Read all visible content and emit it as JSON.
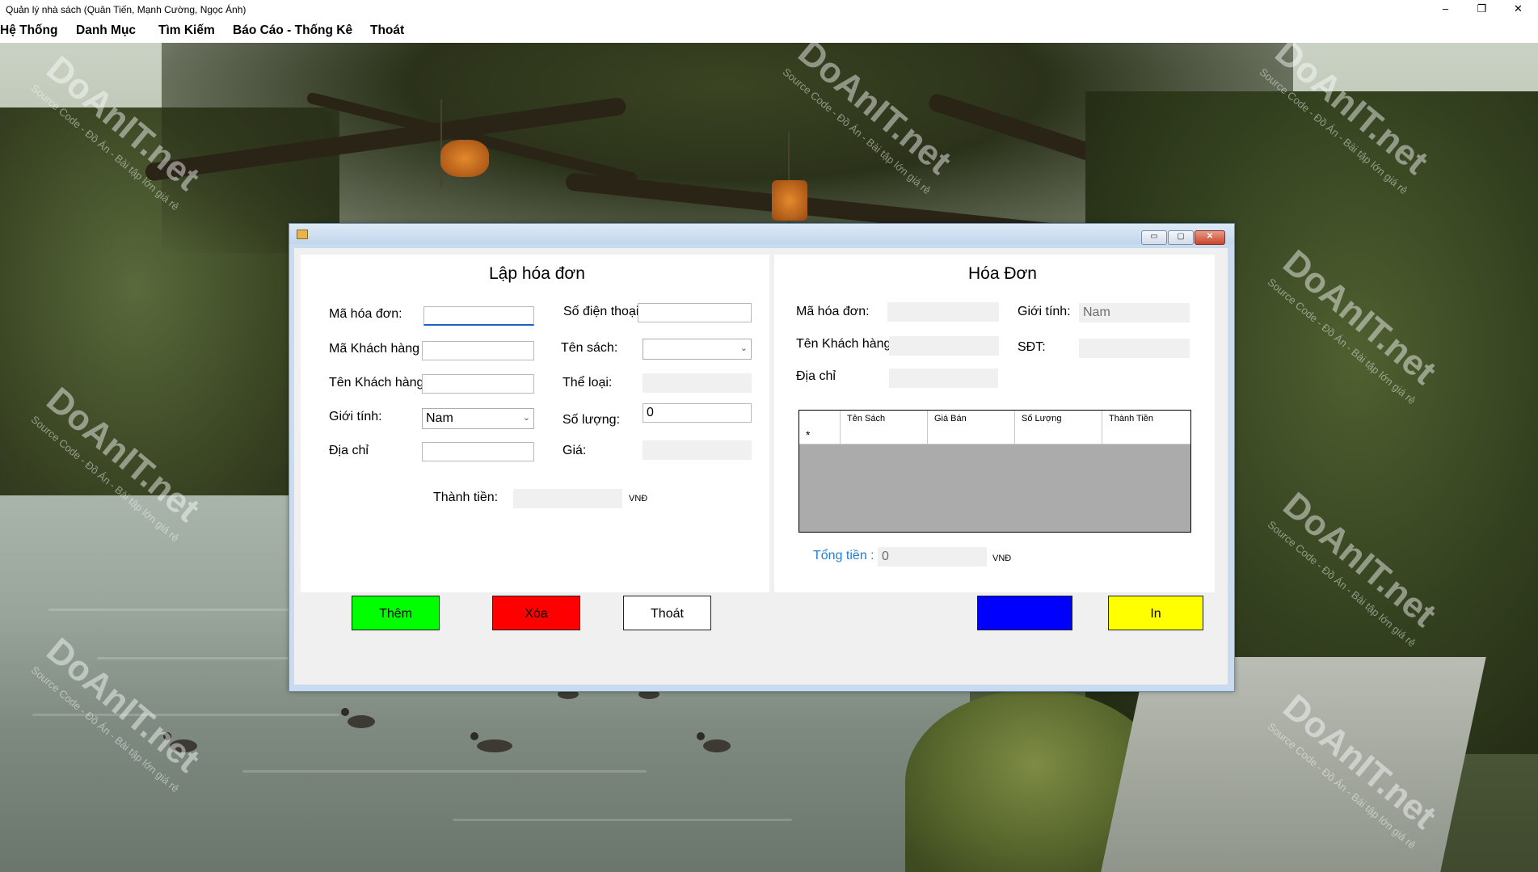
{
  "app": {
    "title": "Quản lý nhà sách (Quân Tiến, Mạnh Cường, Ngọc Ánh)",
    "window_controls": {
      "minimize": "–",
      "restore": "❐",
      "close": "✕"
    }
  },
  "menu": [
    "Hệ Thống",
    "Danh Mục",
    "Tìm Kiếm",
    "Báo Cáo - Thống Kê",
    "Thoát"
  ],
  "watermark": {
    "brand": "DoAnIT.net",
    "tagline": "Source Code - Đồ Án - Bài tập lớn giá rẻ"
  },
  "dialog": {
    "controls": {
      "minimize": "▭",
      "maximize": "▢",
      "close": "✕"
    },
    "left": {
      "heading": "Lập hóa đơn",
      "ma_hoa_don_label": "Mã hóa đơn:",
      "ma_hoa_don_value": "",
      "ma_kh_label": "Mã Khách hàng",
      "ma_kh_value": "",
      "ten_kh_label": "Tên Khách hàng",
      "ten_kh_value": "",
      "gioi_tinh_label": "Giới tính:",
      "gioi_tinh_value": "Nam",
      "dia_chi_label": "Địa chỉ",
      "dia_chi_value": "",
      "sdt_label": "Số điện thoại:",
      "sdt_value": "",
      "ten_sach_label": "Tên sách:",
      "ten_sach_value": "",
      "the_loai_label": "Thể loại:",
      "the_loai_value": "",
      "so_luong_label": "Số lượng:",
      "so_luong_value": "0",
      "gia_label": "Giá:",
      "gia_value": "",
      "thanh_tien_label": "Thành tiền:",
      "thanh_tien_value": "",
      "thanh_tien_unit": "VNĐ"
    },
    "right": {
      "heading": "Hóa Đơn",
      "ma_hoa_don_label": "Mã hóa đơn:",
      "ma_hoa_don_value": "",
      "gioi_tinh_label": "Giới tính:",
      "gioi_tinh_value": "Nam",
      "ten_kh_label": "Tên Khách hàng",
      "ten_kh_value": "",
      "sdt_label": "SĐT:",
      "sdt_value": "",
      "dia_chi_label": "Địa chỉ",
      "dia_chi_value": "",
      "grid": {
        "columns": [
          "Tên Sách",
          "Giá Bán",
          "Số Lượng",
          "Thành Tiền"
        ],
        "new_row_marker": "*"
      },
      "tong_tien_label": "Tổng tiền :",
      "tong_tien_value": "0",
      "tong_tien_unit": "VNĐ"
    },
    "buttons": {
      "them": "Thêm",
      "xoa": "Xóa",
      "thoat": "Thoát",
      "luu": "",
      "in": "In"
    },
    "colors": {
      "them": "#00ff00",
      "xoa": "#ff0000",
      "thoat": "#ffffff",
      "luu": "#0000ff",
      "in": "#ffff00",
      "tong_tien_label": "#1e7fd6"
    }
  }
}
